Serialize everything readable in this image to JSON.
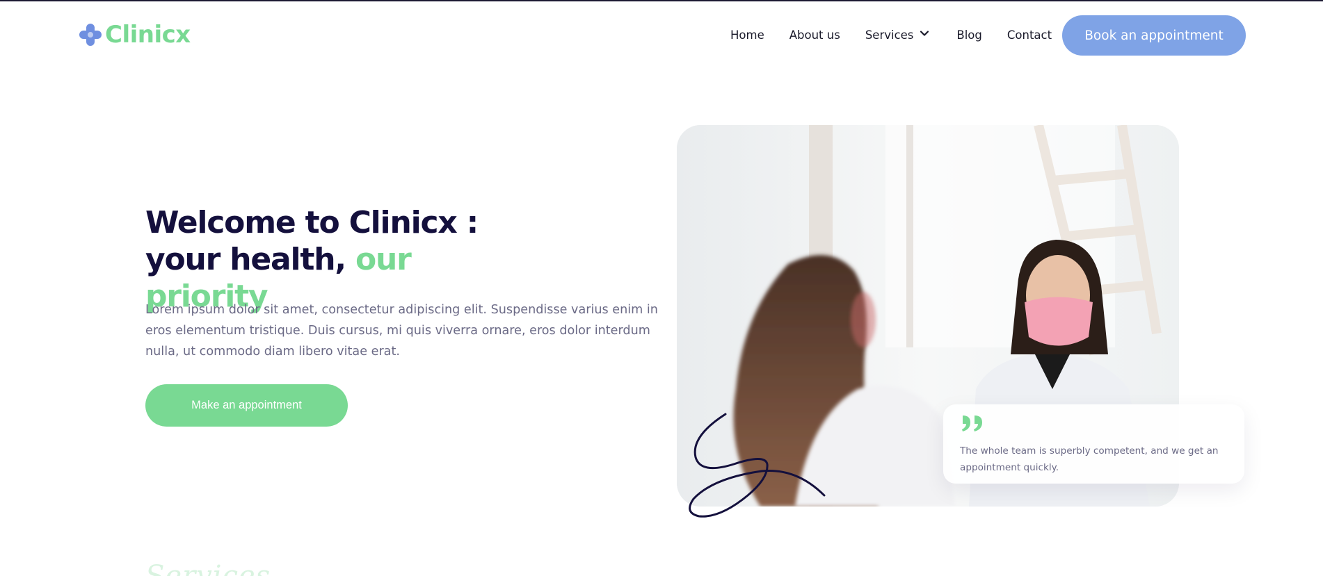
{
  "brand": {
    "name": "Clinicx",
    "colors": {
      "green": "#79d993",
      "blue": "#7fa3e6",
      "navy": "#14103d",
      "muted_text": "#6b6a86"
    }
  },
  "nav": {
    "items": [
      {
        "label": "Home"
      },
      {
        "label": "About us"
      },
      {
        "label": "Services"
      },
      {
        "label": "Blog"
      },
      {
        "label": "Contact"
      }
    ],
    "cta_label": "Book an appointment"
  },
  "hero": {
    "title_main": "Welcome to Clinicx : your health,",
    "title_accent": "our priority",
    "description": "Lorem ipsum dolor sit amet, consectetur adipiscing elit. Suspendisse varius enim in eros elementum tristique. Duis cursus, mi quis viverra ornare, eros dolor interdum nulla, ut commodo diam libero vitae erat.",
    "cta_label": "Make an appointment"
  },
  "testimonial": {
    "icon": "quote-icon",
    "text": "The whole team is superbly competent, and we get an appointment quickly."
  },
  "next_section": {
    "title": "Services"
  }
}
